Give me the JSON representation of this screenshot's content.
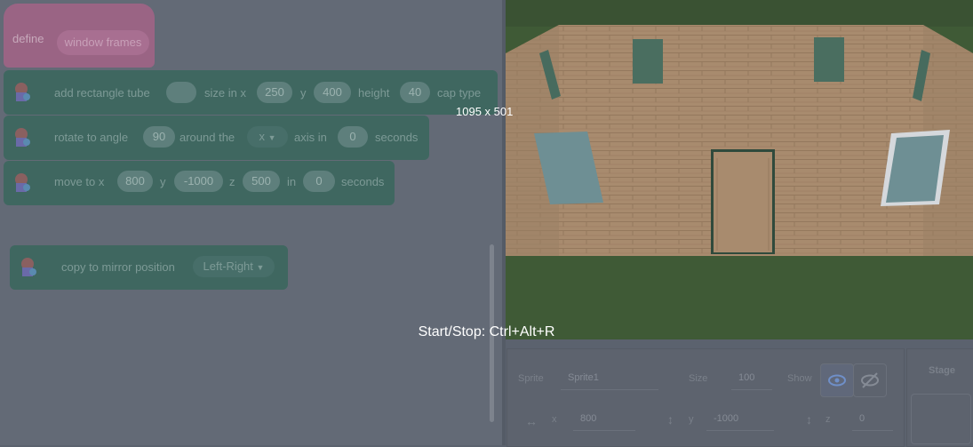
{
  "code": {
    "define_block": {
      "keyword": "define",
      "name": "window frames"
    },
    "tube_block": {
      "label_add": "add rectangle tube",
      "size_label": "size in x",
      "x_value": "250",
      "y_label": "y",
      "y_value": "400",
      "height_label": "height",
      "height_value": "40",
      "cap_label": "cap type"
    },
    "rotate_block": {
      "label": "rotate to angle",
      "angle": "90",
      "around_label": "around the",
      "axis_value": "x",
      "axis_label": "axis in",
      "seconds_value": "0",
      "seconds_label": "seconds"
    },
    "move_block": {
      "label": "move to x",
      "x_value": "800",
      "y_label": "y",
      "y_value": "-1000",
      "z_label": "z",
      "z_value": "500",
      "in_label": "in",
      "seconds_value": "0",
      "seconds_label": "seconds"
    },
    "mirror_block": {
      "label": "copy to mirror position",
      "option": "Left-Right"
    }
  },
  "overlay": {
    "dimensions": "1095 x 501",
    "shortcut": "Start/Stop: Ctrl+Alt+R"
  },
  "sprite_info": {
    "sprite_label": "Sprite",
    "sprite_name": "Sprite1",
    "size_label": "Size",
    "size_value": "100",
    "show_label": "Show",
    "x_label": "x",
    "x_value": "800",
    "y_label": "y",
    "y_value": "-1000",
    "z_label": "z",
    "z_value": "0"
  },
  "stage_panel": {
    "title": "Stage"
  },
  "icons": [
    "extension-block-icon",
    "dropdown-caret-icon",
    "eye-icon",
    "eye-slash-icon",
    "horizontal-arrows-icon",
    "vertical-arrows-icon"
  ],
  "colors": {
    "hat_block": "#9a6484",
    "code_block": "#3f6760",
    "wall": "#a88b6e",
    "grass": "#3f5a36",
    "window": "#6e8f94"
  }
}
